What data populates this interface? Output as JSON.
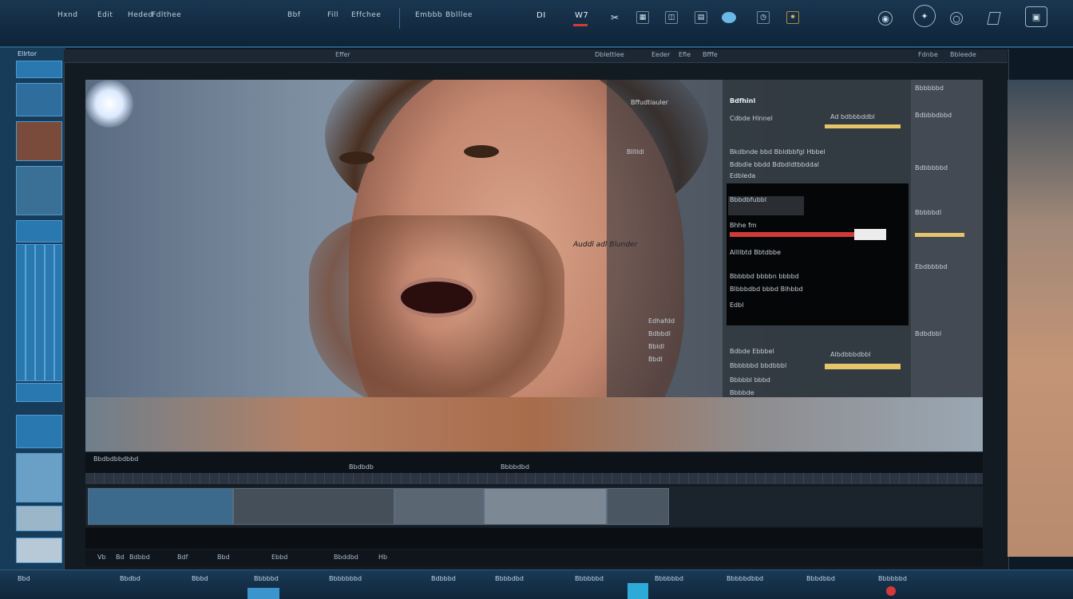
{
  "topbar": {
    "menu": [
      "Hxnd",
      "Edit",
      "Heded",
      "Fdlthee",
      "Bbf",
      "Fill",
      "Effchee",
      "Embbb",
      "Bblllee"
    ],
    "tools": {
      "readout_1": "DI",
      "readout_2": "W7"
    }
  },
  "left_panel": {
    "title": "Ellrtor"
  },
  "window": {
    "tabs": [
      "Effer",
      "Dblettlee"
    ],
    "right_labels": [
      "Eeder",
      "Efle",
      "Bfffe",
      "Fdnbe",
      "Bbleede"
    ]
  },
  "viewer": {
    "overlay_text": [
      "Auddl adl Blunder",
      "Bffudtiauler",
      "Blllldl"
    ],
    "mid_labels": [
      "Edhafdd",
      "Bdbbdl",
      "Bbldl",
      "Bbdl"
    ],
    "panel": {
      "header": "Bdfhinl",
      "rows": [
        "Cdbde Hlnnel",
        "Bkdbnde bbd Bbldbbfgl Hbbel",
        "Bdbdle bbdd Bdbdldtbbddal",
        "Edbleda"
      ],
      "black_section": {
        "title": "Bbbdbfubbl",
        "bar_label": "Bhhe fm",
        "line_1": "Allllbtd Bbtdbbe",
        "line_2": "Bbbbbd bbbbn bbbbd",
        "line_3": "Blbbbdbd bbbd Blhbbd",
        "line_4": "Edbl"
      },
      "bottom_rows": [
        "Bdbde Ebbbel",
        "Bbbbbbd bbdbbbl",
        "Bbbbbl bbbd",
        "Bbbbde"
      ],
      "yellow_bar_labels": [
        "Ad bdbbbddbl",
        "Albdbbbdbbl"
      ]
    },
    "right_column": [
      "Bbbbbbd",
      "Bdbbbdbbd",
      "Bdbbbbbd",
      "Bbbbbdl",
      "Ebdbbbbd",
      "Bdbdbbl"
    ]
  },
  "timeline": {
    "labels": [
      "Bbdbdbbdbbd",
      "Bbdbdb",
      "Bbbbdbd"
    ],
    "footer": [
      "Vb",
      "Bd",
      "Bdbbd",
      "Bdf",
      "Bbd",
      "Ebbd",
      "Bbddbd",
      "Hb"
    ]
  },
  "taskbar": {
    "items": [
      "Bbd",
      "Bbdbd",
      "Bbbd",
      "Bbbbbd",
      "Bbbbbbbd",
      "Bdbbbd",
      "Bbbbdbd",
      "Bbbbbbd",
      "Bbbbbbd",
      "Bbbbbdbbd",
      "Bbbdbbd",
      "Bbbbbbd"
    ]
  },
  "colors": {
    "accent": "#2a78b0",
    "highlight_yellow": "#e6c46a",
    "highlight_red": "#d23a3a"
  },
  "icons": [
    "search-icon",
    "gear-icon",
    "crop-icon",
    "paint-icon",
    "camera-icon",
    "lens-icon",
    "clock-icon",
    "settings-icon",
    "monitor-icon"
  ]
}
